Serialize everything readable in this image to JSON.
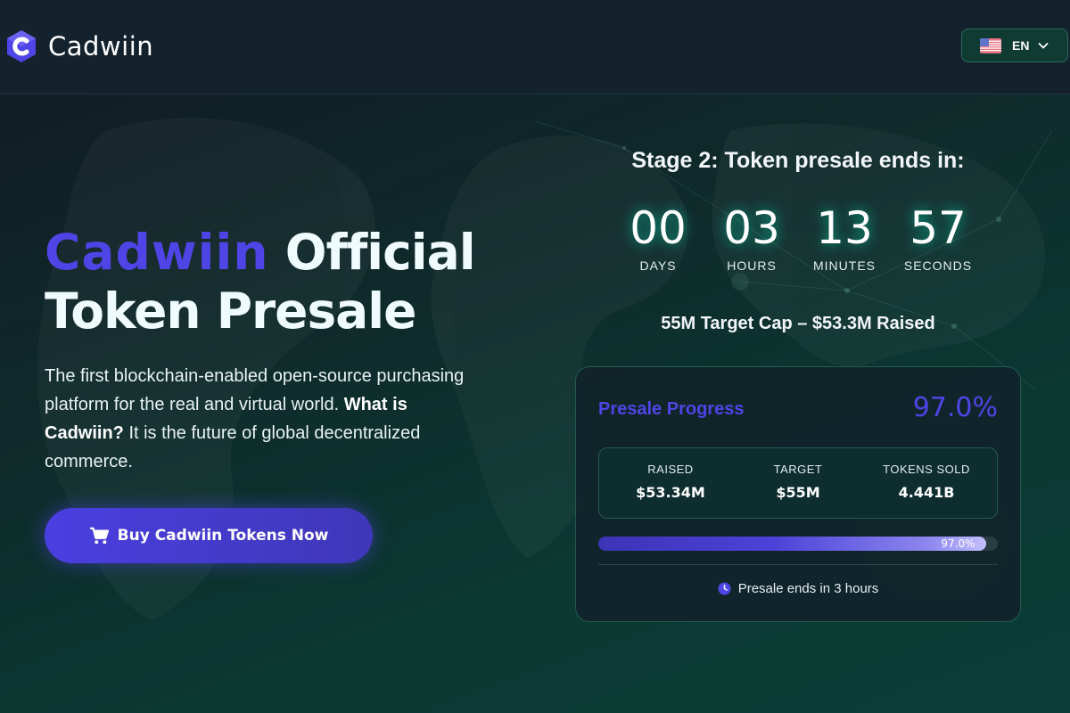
{
  "header": {
    "brand": "Cadwiin",
    "language": {
      "label": "EN",
      "flag_icon": "us-flag-icon"
    }
  },
  "hero": {
    "brand_word": "Cadwiin",
    "title_after_brand": "Official",
    "title_line2": "Token Presale",
    "description_start": "The first blockchain-enabled open-source purchasing platform for the real and virtual world. ",
    "description_bold": "What is Cadwiin?",
    "description_end": " It is the future of global decentralized commerce.",
    "cta_label": "Buy Cadwiin Tokens Now",
    "cta_icon": "cart-icon"
  },
  "presale": {
    "stage_title": "Stage 2: Token presale ends in:",
    "countdown": [
      {
        "value": "00",
        "label": "DAYS"
      },
      {
        "value": "03",
        "label": "HOURS"
      },
      {
        "value": "13",
        "label": "MINUTES"
      },
      {
        "value": "57",
        "label": "SECONDS"
      }
    ],
    "cap_text": "55M Target Cap – $53.3M Raised",
    "card": {
      "title": "Presale Progress",
      "percent": "97.0%",
      "progress_fraction": 0.97,
      "stats": [
        {
          "label": "RAISED",
          "value": "$53.34M"
        },
        {
          "label": "TARGET",
          "value": "$55M"
        },
        {
          "label": "TOKENS SOLD",
          "value": "4.441B"
        }
      ],
      "bar_label": "97.0%",
      "ends_text": "Presale ends in 3 hours",
      "ends_icon": "clock-icon"
    }
  },
  "colors": {
    "accent": "#4f45e6",
    "background": "#0f2a2a",
    "header_bg": "#14222d"
  }
}
